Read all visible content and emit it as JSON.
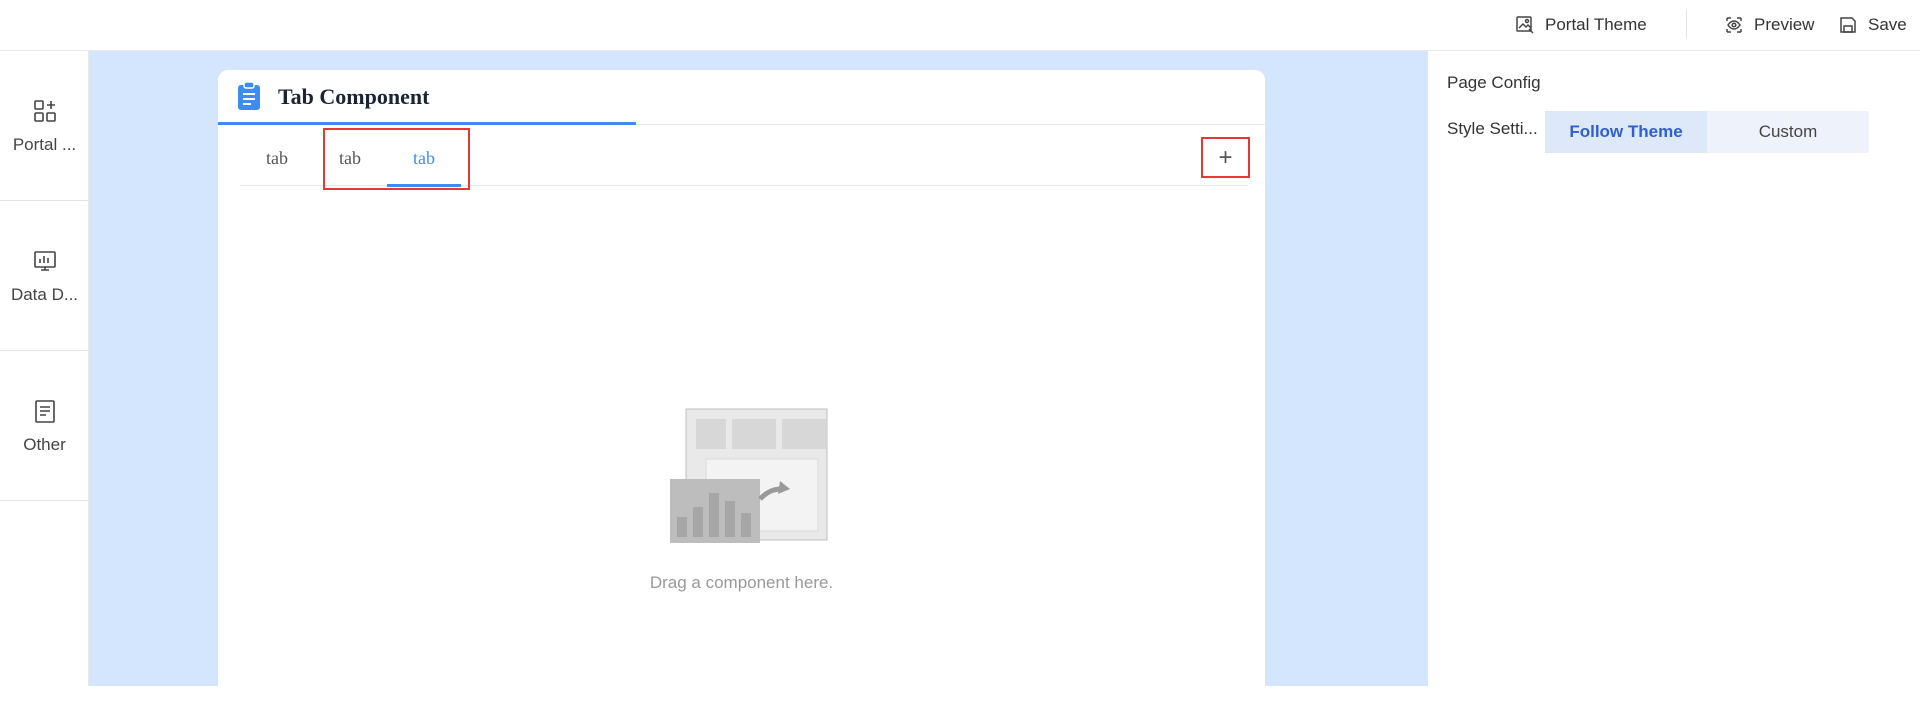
{
  "topbar": {
    "portal_theme": "Portal Theme",
    "preview": "Preview",
    "save": "Save"
  },
  "leftbar": {
    "items": [
      {
        "label": "Portal ...",
        "icon": "component-grid-icon"
      },
      {
        "label": "Data D...",
        "icon": "chart-board-icon"
      },
      {
        "label": "Other",
        "icon": "document-icon"
      }
    ]
  },
  "card": {
    "title": "Tab Component",
    "tabs": [
      "tab",
      "tab",
      "tab"
    ],
    "active_tab_index": 2,
    "add_label": "+",
    "empty_text": "Drag a component here."
  },
  "rightpanel": {
    "title": "Page Config",
    "style_label": "Style Setti...",
    "options": [
      "Follow Theme",
      "Custom"
    ],
    "selected": "Follow Theme"
  },
  "colors": {
    "accent": "#3c8cf2",
    "canvas": "#d4e6fd",
    "highlight": "#e53935"
  }
}
